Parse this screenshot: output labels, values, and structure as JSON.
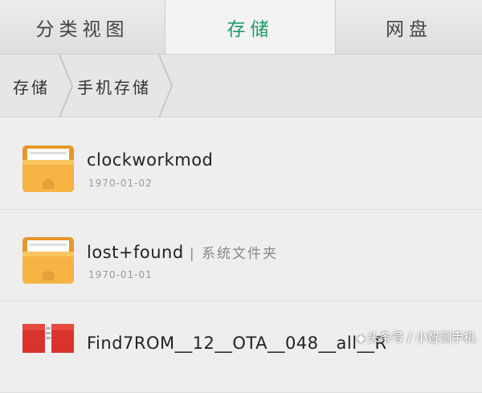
{
  "tabs": [
    {
      "label": "分类视图",
      "active": false
    },
    {
      "label": "存储",
      "active": true
    },
    {
      "label": "网盘",
      "active": false
    }
  ],
  "breadcrumb": [
    "存储",
    "手机存储"
  ],
  "files": [
    {
      "name": "clockworkmod",
      "tag": "",
      "date": "1970-01-02",
      "icon": "folder-icon"
    },
    {
      "name": "lost+found",
      "tag": "| 系统文件夹",
      "date": "1970-01-01",
      "icon": "folder-icon"
    },
    {
      "name": "Find7ROM__12__OTA__048__all__R",
      "tag": "",
      "date": "",
      "icon": "zip-archive-icon"
    }
  ],
  "watermark": "头条号 / 小智测手机",
  "colors": {
    "active_tab": "#1d9a67",
    "folder": "#f2a93a",
    "zip": "#d9342b"
  }
}
